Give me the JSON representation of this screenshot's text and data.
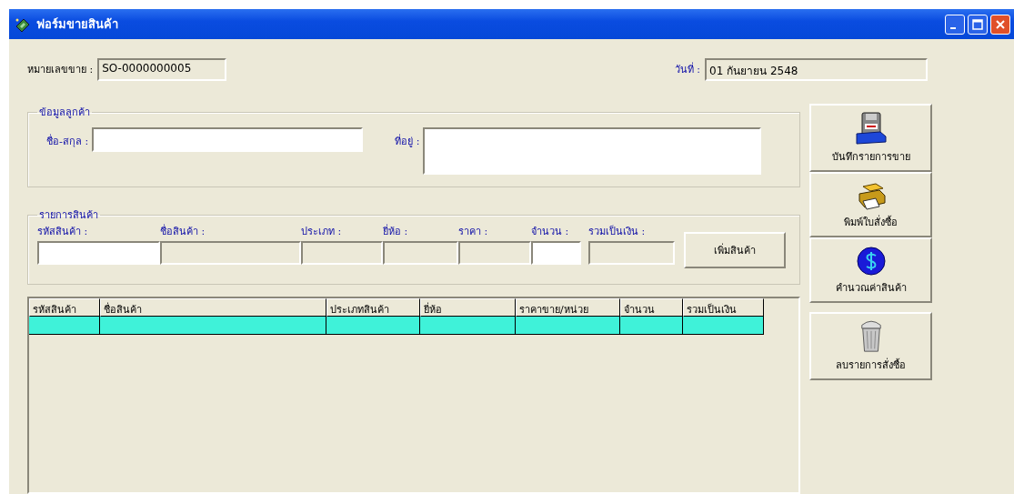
{
  "window": {
    "title": "ฟอร์มขายสินค้า"
  },
  "header": {
    "sale_number": {
      "label": "หมายเลขขาย :",
      "value": "SO-0000000005"
    },
    "date": {
      "label": "วันที่ :",
      "value": "01 กันยายน 2548"
    }
  },
  "customer": {
    "title": "ข้อมูลลูกค้า",
    "fields": [
      {
        "label": "ชื่อ-สกุล :",
        "kind": "line"
      },
      {
        "label": "ที่อยู่ :",
        "kind": "area"
      }
    ]
  },
  "product": {
    "title": "รายการสินค้า",
    "fields": [
      {
        "label": "รหัสสินค้า :",
        "editable": true
      },
      {
        "label": "ชื่อสินค้า :",
        "editable": false
      },
      {
        "label": "ประเภท :",
        "editable": false
      },
      {
        "label": "ยี่ห้อ :",
        "editable": false
      },
      {
        "label": "ราคา :",
        "editable": false
      },
      {
        "label": "จำนวน :",
        "editable": true
      },
      {
        "label": "รวมเป็นเงิน :",
        "editable": false
      }
    ],
    "add_button": "เพิ่มสินค้า"
  },
  "table": {
    "columns": [
      "รหัสสินค้า",
      "ชื่อสินค้า",
      "ประเภทสินค้า",
      "ยี่ห้อ",
      "ราคาขาย/หน่วย",
      "จำนวน",
      "รวมเป็นเงิน"
    ],
    "rows": [
      {
        "selected": true
      }
    ]
  },
  "actions": [
    {
      "label": "บันทึกรายการขาย",
      "kind": "save"
    },
    {
      "label": "พิมพ์ใบสั่งซื้อ",
      "kind": "print"
    },
    {
      "label": "คำนวณค่าสินค้า",
      "kind": "calculate"
    },
    {
      "label": "ลบรายการสั่งซื้อ",
      "kind": "delete"
    }
  ]
}
